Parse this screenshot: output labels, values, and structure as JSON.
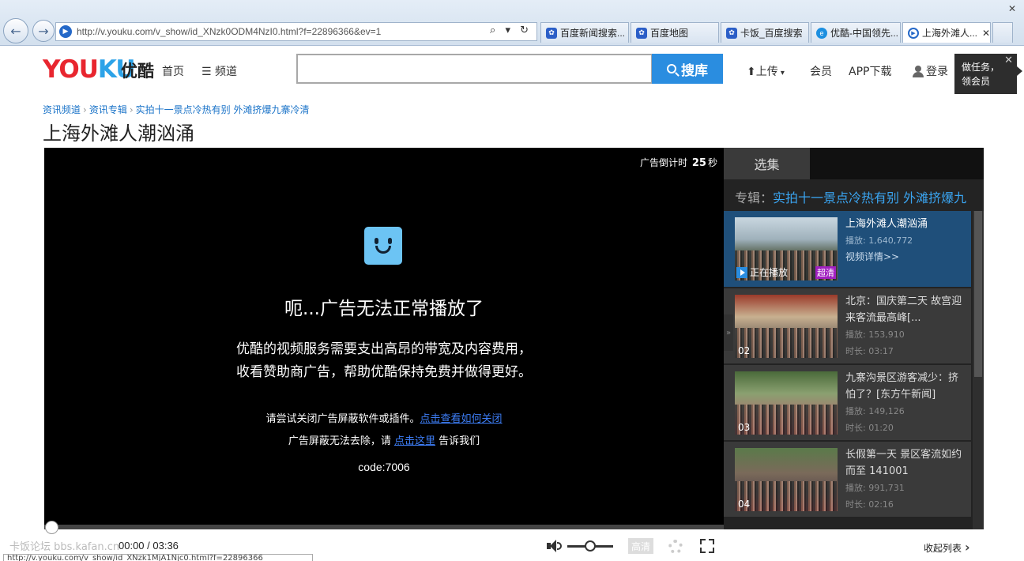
{
  "browser": {
    "address": "http://v.youku.com/v_show/id_XNzk0ODM4NzI0.html?f=22896366&ev=1",
    "address_tools": "⌕ ▾ ↻",
    "tabs": [
      {
        "label": "百度新闻搜索...",
        "icon": "baidu-paw-icon"
      },
      {
        "label": "百度地图",
        "icon": "baidu-paw-icon"
      },
      {
        "label": "卡饭_百度搜索",
        "icon": "baidu-paw-icon"
      },
      {
        "label": "优酷-中国领先...",
        "icon": "ie-icon"
      },
      {
        "label": "上海外滩人...",
        "icon": "youku-play-icon",
        "active": true
      }
    ],
    "status_url": "http://v.youku.com/v_show/id_XNzk1MjA1Njc0.html?f=22896366"
  },
  "header": {
    "logo_text_a": "YOU",
    "logo_text_b": "KU",
    "logo_cn": "优酷",
    "nav_home": "首页",
    "nav_channel": "频道",
    "search_placeholder": "",
    "search_button": "搜库",
    "upload": "上传",
    "vip": "会员",
    "app": "APP下载",
    "login": "登录",
    "task_line1": "做任务，",
    "task_line2": "领会员"
  },
  "breadcrumb": [
    "资讯频道",
    "资讯专辑",
    "实拍十一景点冷热有别 外滩挤爆九寨冷清"
  ],
  "page_title": "上海外滩人潮汹涌",
  "player": {
    "countdown_label": "广告倒计时",
    "countdown_value": "25",
    "countdown_unit": "秒",
    "error_title": "呃...广告无法正常播放了",
    "error_line1": "优酷的视频服务需要支出高昂的带宽及内容费用，",
    "error_line2": "收看赞助商广告，帮助优酷保持免费并做得更好。",
    "hint1_text": "请尝试关闭广告屏蔽软件或插件。",
    "hint1_link": "点击查看如何关闭",
    "hint2_prefix": "广告屏蔽无法去除，请",
    "hint2_link": "点击这里",
    "hint2_suffix": "告诉我们",
    "code": "code:7006"
  },
  "sidebar": {
    "tab": "选集",
    "album_label": "专辑：",
    "album_name": "实拍十一景点冷热有别 外滩挤爆九",
    "items": [
      {
        "title": "上海外滩人潮汹涌",
        "plays": "播放: 1,640,772",
        "detail": "视频详情>>",
        "playing": "正在播放",
        "badge": "超清"
      },
      {
        "title": "北京：国庆第二天 故宫迎来客流最高峰[...",
        "plays": "播放: 153,910",
        "duration": "时长: 03:17",
        "num": "02"
      },
      {
        "title": "九寨沟景区游客减少：挤怕了？[东方午新闻]",
        "plays": "播放: 149,126",
        "duration": "时长: 01:20",
        "num": "03"
      },
      {
        "title": "长假第一天 景区客流如约而至 141001",
        "plays": "播放: 991,731",
        "duration": "时长: 02:16",
        "num": "04"
      }
    ]
  },
  "controls": {
    "time": "00:00 / 03:36",
    "quality": "高清",
    "collapse": "收起列表",
    "watermark": "卡饭论坛 bbs.kafan.cn"
  }
}
